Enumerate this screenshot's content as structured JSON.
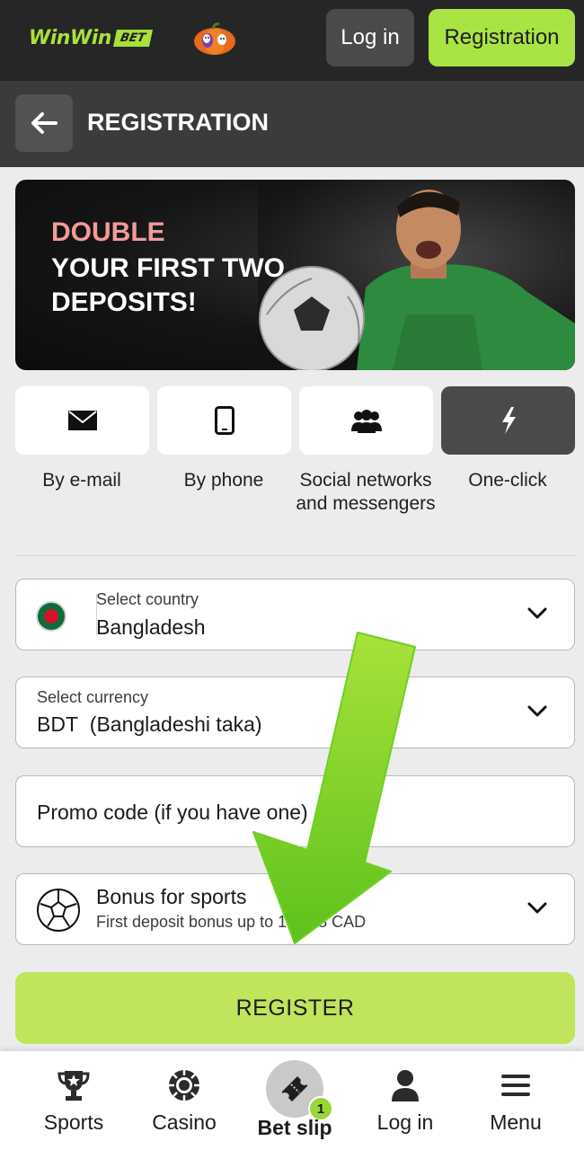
{
  "header": {
    "logo_text": "WinWin",
    "logo_badge": "BET",
    "login_label": "Log in",
    "registration_label": "Registration"
  },
  "titlebar": {
    "title": "REGISTRATION"
  },
  "banner": {
    "line1": "DOUBLE",
    "line2": "YOUR FIRST TWO DEPOSITS!"
  },
  "methods": [
    {
      "label": "By e-mail",
      "icon": "envelope-icon",
      "active": false
    },
    {
      "label": "By phone",
      "icon": "phone-icon",
      "active": false
    },
    {
      "label": "Social networks and messengers",
      "icon": "people-icon",
      "active": false
    },
    {
      "label": "One-click",
      "icon": "lightning-icon",
      "active": true
    }
  ],
  "form": {
    "country": {
      "label": "Select country",
      "value": "Bangladesh"
    },
    "currency": {
      "label": "Select currency",
      "code": "BDT",
      "name": "(Bangladeshi taka)"
    },
    "promo": {
      "placeholder": "Promo code (if you have one)"
    },
    "bonus": {
      "title": "Bonus for sports",
      "subtitle": "First deposit bonus up to 163.18 CAD"
    },
    "register_label": "REGISTER"
  },
  "bottom_nav": {
    "sports": "Sports",
    "casino": "Casino",
    "betslip": "Bet slip",
    "betslip_count": "1",
    "login": "Log in",
    "menu": "Menu"
  },
  "colors": {
    "accent": "#a9e445",
    "header_bg": "#262626",
    "register_bg": "#bfe55c"
  }
}
